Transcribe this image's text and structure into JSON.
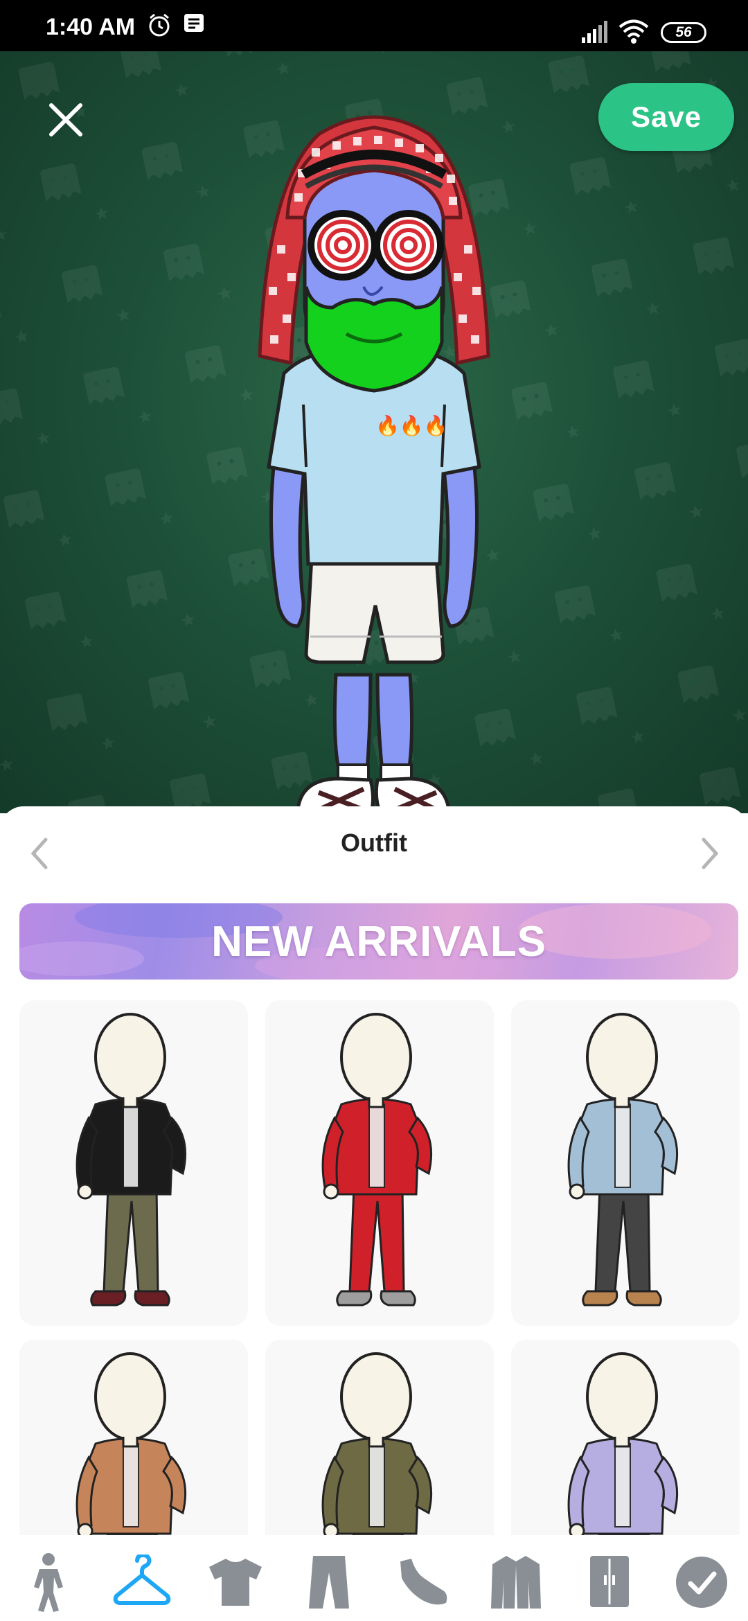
{
  "status_bar": {
    "time": "1:40 AM",
    "battery": "56",
    "icons": [
      "alarm-icon",
      "message-icon",
      "signal-icon",
      "wifi-icon",
      "battery-icon"
    ]
  },
  "header": {
    "save_label": "Save",
    "close_icon": "close-icon"
  },
  "avatar": {
    "shirt_decal": "🔥🔥🔥"
  },
  "sheet": {
    "title": "Outfit",
    "banner": "NEW ARRIVALS",
    "outfits": [
      {
        "name": "outfit-black-jacket-olive-pants",
        "top": "#1b1b1b",
        "pants": "#6c6b4e",
        "shoes": "#6a1f25"
      },
      {
        "name": "outfit-red-tracksuit",
        "top": "#d0202a",
        "pants": "#d0202a",
        "shoes": "#9e9e9e"
      },
      {
        "name": "outfit-denim-jacket-grey-pants",
        "top": "#a3bfd6",
        "pants": "#444444",
        "shoes": "#b9834f"
      },
      {
        "name": "outfit-tan-jacket",
        "top": "#c6845a",
        "pants": "#333333",
        "shoes": "#333333"
      },
      {
        "name": "outfit-olive-blazer",
        "top": "#6e6a44",
        "pants": "#5a5636",
        "shoes": "#333333"
      },
      {
        "name": "outfit-lavender-jacket",
        "top": "#b6aee0",
        "pants": "#2b2f4d",
        "shoes": "#333333"
      }
    ]
  },
  "toolbar": {
    "items": [
      {
        "icon": "body-icon",
        "active": false
      },
      {
        "icon": "hanger-icon",
        "active": true
      },
      {
        "icon": "tshirt-icon",
        "active": false
      },
      {
        "icon": "pants-icon",
        "active": false
      },
      {
        "icon": "shoe-icon",
        "active": false
      },
      {
        "icon": "jacket-icon",
        "active": false
      },
      {
        "icon": "wardrobe-icon",
        "active": false
      },
      {
        "icon": "checkmark-icon",
        "active": false
      }
    ]
  },
  "colors": {
    "accent": "#2bc386",
    "active_tab": "#1ea7f5",
    "inactive_tab": "#8a8f96"
  }
}
